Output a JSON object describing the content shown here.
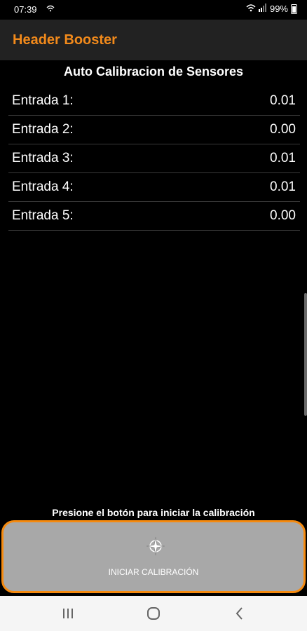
{
  "status_bar": {
    "time": "07:39",
    "battery": "99%"
  },
  "app_bar": {
    "title": "Header Booster"
  },
  "main": {
    "section_title": "Auto Calibracion de Sensores",
    "sensors": [
      {
        "label": "Entrada 1:",
        "value": "0.01"
      },
      {
        "label": "Entrada 2:",
        "value": "0.00"
      },
      {
        "label": "Entrada 3:",
        "value": "0.01"
      },
      {
        "label": "Entrada 4:",
        "value": "0.01"
      },
      {
        "label": "Entrada 5:",
        "value": "0.00"
      }
    ],
    "hint": "Presione el botón para iniciar la calibración",
    "button_label": "INICIAR CALIBRACIÓN",
    "button_icon": "compass-star-icon"
  },
  "colors": {
    "accent": "#f28a1b",
    "app_bar_bg": "#222222",
    "button_bg": "#a8a8a8"
  },
  "nav_bar": {
    "items": [
      "recent-apps-icon",
      "home-icon",
      "back-icon"
    ]
  }
}
